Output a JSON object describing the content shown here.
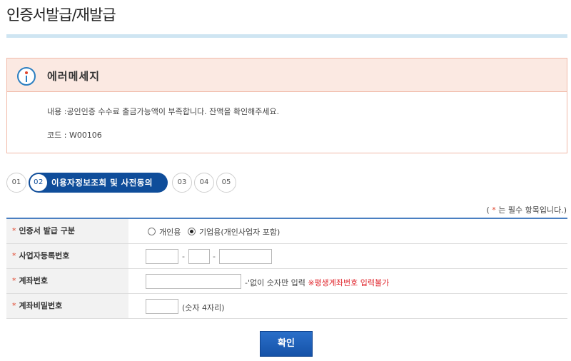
{
  "page": {
    "title": "인증서발급/재발급"
  },
  "error": {
    "title": "에러메세지",
    "content": "내용 :공인인증 수수료 출금가능액이 부족합니다. 잔액을 확인해주세요.",
    "code": "코드 : W00106"
  },
  "steps": {
    "items": [
      {
        "num": "01"
      },
      {
        "num": "02",
        "label": "이용자정보조회 및 사전동의"
      },
      {
        "num": "03"
      },
      {
        "num": "04"
      },
      {
        "num": "05"
      }
    ],
    "active_index": 1
  },
  "required_note": {
    "open": "( ",
    "star": "*",
    "text": " 는 필수 항목입니다.)"
  },
  "form": {
    "star": "*",
    "cert_type": {
      "label": "인증서 발급 구분",
      "options": [
        "개인용",
        "기업용(개인사업자 포함)"
      ],
      "selected": "기업용(개인사업자 포함)"
    },
    "biz_number": {
      "label": "사업자등록번호",
      "sep": "-",
      "values": [
        "",
        "",
        ""
      ]
    },
    "account": {
      "label": "계좌번호",
      "value": "",
      "hint": "-'없이 숫자만 입력",
      "warn": "※평생계좌번호 입력불가"
    },
    "password": {
      "label": "계좌비밀번호",
      "value": "",
      "hint": "(숫자 4자리)"
    }
  },
  "actions": {
    "confirm_label": "확인"
  },
  "colors": {
    "accent": "#0f4d9a",
    "error_bg": "#fbe9e2",
    "required": "#e0462d"
  }
}
